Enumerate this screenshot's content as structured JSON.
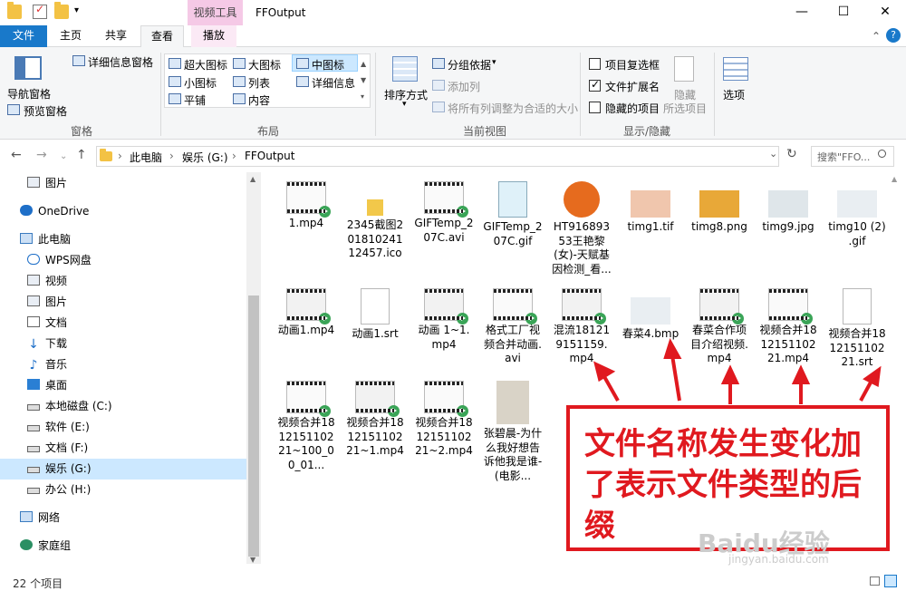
{
  "titlebar": {
    "context_tab": "视频工具",
    "title": "FFOutput",
    "minimize": "—",
    "maximize": "☐",
    "close": "✕"
  },
  "tabs": {
    "file": "文件",
    "home": "主页",
    "share": "共享",
    "view": "查看",
    "play": "播放"
  },
  "ribbon": {
    "pane": {
      "nav_pane": "导航窗格",
      "preview_pane": "预览窗格",
      "details_pane": "详细信息窗格",
      "group": "窗格"
    },
    "layout": {
      "xl_icons": "超大图标",
      "l_icons": "大图标",
      "m_icons": "中图标",
      "s_icons": "小图标",
      "list": "列表",
      "details": "详细信息",
      "tiles": "平铺",
      "content": "内容",
      "group": "布局"
    },
    "view": {
      "sort_by": "排序方式",
      "group_by": "分组依据",
      "add_columns": "添加列",
      "size_columns": "将所有列调整为合适的大小",
      "group": "当前视图"
    },
    "showhide": {
      "item_checkbox": "项目复选框",
      "file_ext": "文件扩展名",
      "hidden_items": "隐藏的项目",
      "hide": "隐藏",
      "selected_items": "所选项目",
      "group": "显示/隐藏"
    },
    "options": "选项"
  },
  "address": {
    "segments": [
      "此电脑",
      "娱乐 (G:)",
      "FFOutput"
    ],
    "search_placeholder": "搜索\"FFO...",
    "nav_back": "←",
    "nav_fwd": "→",
    "nav_up": "↑",
    "sep": "›",
    "dropdown": "⌄",
    "refresh": "↻",
    "collapse": "⌃",
    "help": "?"
  },
  "sidebar": {
    "items": [
      "图片",
      "OneDrive",
      "此电脑",
      "WPS网盘",
      "视频",
      "图片",
      "文档",
      "下载",
      "音乐",
      "桌面",
      "本地磁盘 (C:)",
      "软件 (E:)",
      "文档 (F:)",
      "娱乐 (G:)",
      "办公 (H:)",
      "网络",
      "家庭组"
    ],
    "selected_index": 13
  },
  "files": [
    {
      "name": "1.mp4",
      "kind": "video"
    },
    {
      "name": "2345截图20181024112457.ico",
      "kind": "ico"
    },
    {
      "name": "GIFTemp_207C.avi",
      "kind": "video"
    },
    {
      "name": "GIFTemp_207C.gif",
      "kind": "gif"
    },
    {
      "name": "HT91689353王艳黎(女)-天赋基因检测_看...",
      "kind": "app"
    },
    {
      "name": "timg1.tif",
      "kind": "image"
    },
    {
      "name": "timg8.png",
      "kind": "image"
    },
    {
      "name": "timg9.jpg",
      "kind": "image"
    },
    {
      "name": "timg10 (2) .gif",
      "kind": "image"
    },
    {
      "name": "动画1.mp4",
      "kind": "video"
    },
    {
      "name": "动画1.srt",
      "kind": "doc"
    },
    {
      "name": "动画 1~1.mp4",
      "kind": "video"
    },
    {
      "name": "格式工厂视频合并动画.avi",
      "kind": "video"
    },
    {
      "name": "混流181219151159.mp4",
      "kind": "video"
    },
    {
      "name": "春菜4.bmp",
      "kind": "image"
    },
    {
      "name": "春菜合作项目介绍视频.mp4",
      "kind": "video"
    },
    {
      "name": "视频合并181215110221.mp4",
      "kind": "video"
    },
    {
      "name": "视频合并181215110221.srt",
      "kind": "doc"
    },
    {
      "name": "视频合并181215110221~100_00_01...",
      "kind": "video"
    },
    {
      "name": "视频合并181215110221~1.mp4",
      "kind": "video"
    },
    {
      "name": "视频合并181215110221~2.mp4",
      "kind": "video"
    },
    {
      "name": "张碧晨-为什么我好想告诉他我是谁-(电影...",
      "kind": "image"
    }
  ],
  "annotation": "文件名称发生变化加了表示文件类型的后缀",
  "watermark": "Baidu经验",
  "watermark_url": "jingyan.baidu.com",
  "status": "22 个项目",
  "colors": {
    "accent": "#1979ca",
    "annotation": "#e0191f",
    "context_tab": "#f5c9e6"
  }
}
